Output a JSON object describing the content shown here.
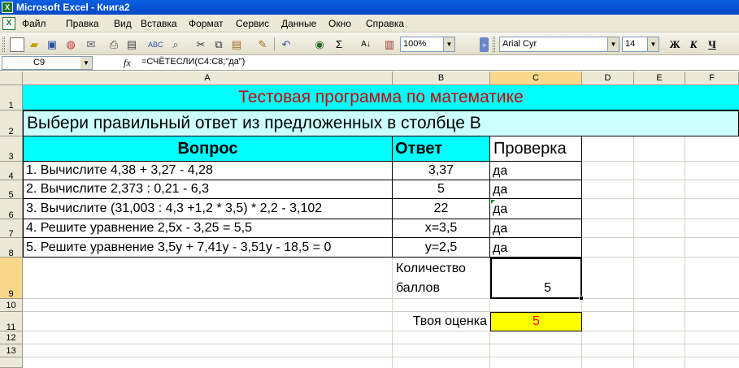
{
  "window": {
    "title": "Microsoft Excel - Книга2"
  },
  "menu": [
    "Файл",
    "Правка",
    "Вид",
    "Вставка",
    "Формат",
    "Сервис",
    "Данные",
    "Окно",
    "Справка"
  ],
  "toolbar": {
    "zoom": "100%",
    "font_name": "Arial Cyr",
    "font_size": "14",
    "bold_label": "Ж",
    "italic_label": "К",
    "underline_label": "Ч",
    "sum_label": "Σ",
    "sort_label": "А↓"
  },
  "formula_bar": {
    "name_box": "C9",
    "fx": "fx",
    "formula": "=СЧЁТЕСЛИ(C4:C8;\"да\")"
  },
  "columns": [
    "A",
    "B",
    "C",
    "D",
    "E",
    "F"
  ],
  "rows": [
    "1",
    "2",
    "3",
    "4",
    "5",
    "6",
    "7",
    "8",
    "9",
    "10",
    "11",
    "12",
    "13"
  ],
  "sheet": {
    "r1": "Тестовая программа по математике",
    "r2": "Выбери правильный ответ из предложенных в столбце В",
    "h_question": "Вопрос",
    "h_answer": "Ответ",
    "h_check": "Проверка",
    "q1": "1. Вычислите 4,38 + 3,27 - 4,28",
    "q2": "2. Вычислите 2,373 : 0,21 - 6,3",
    "q3": "3. Вычислите (31,003 : 4,3 +1,2 * 3,5) * 2,2 - 3,102",
    "q4": "4. Решите уравнение 2,5х - 3,25 = 5,5",
    "q5": "5. Решите уравнение 3,5у + 7,41у - 3,51у - 18,5 = 0",
    "a1": "3,37",
    "a2": "5",
    "a3": "22",
    "a4": "х=3,5",
    "a5": "у=2,5",
    "c1": "да",
    "c2": "да",
    "c3": "да",
    "c4": "да",
    "c5": "да",
    "count_label_1": "Количество",
    "count_label_2": "баллов",
    "count_value": "5",
    "grade_label": "Твоя оценка",
    "grade_value": "5"
  },
  "colors": {
    "title_red": "#cc0000",
    "cyan": "#00ffff",
    "light_cyan": "#ccffff",
    "yellow": "#ffff00"
  }
}
